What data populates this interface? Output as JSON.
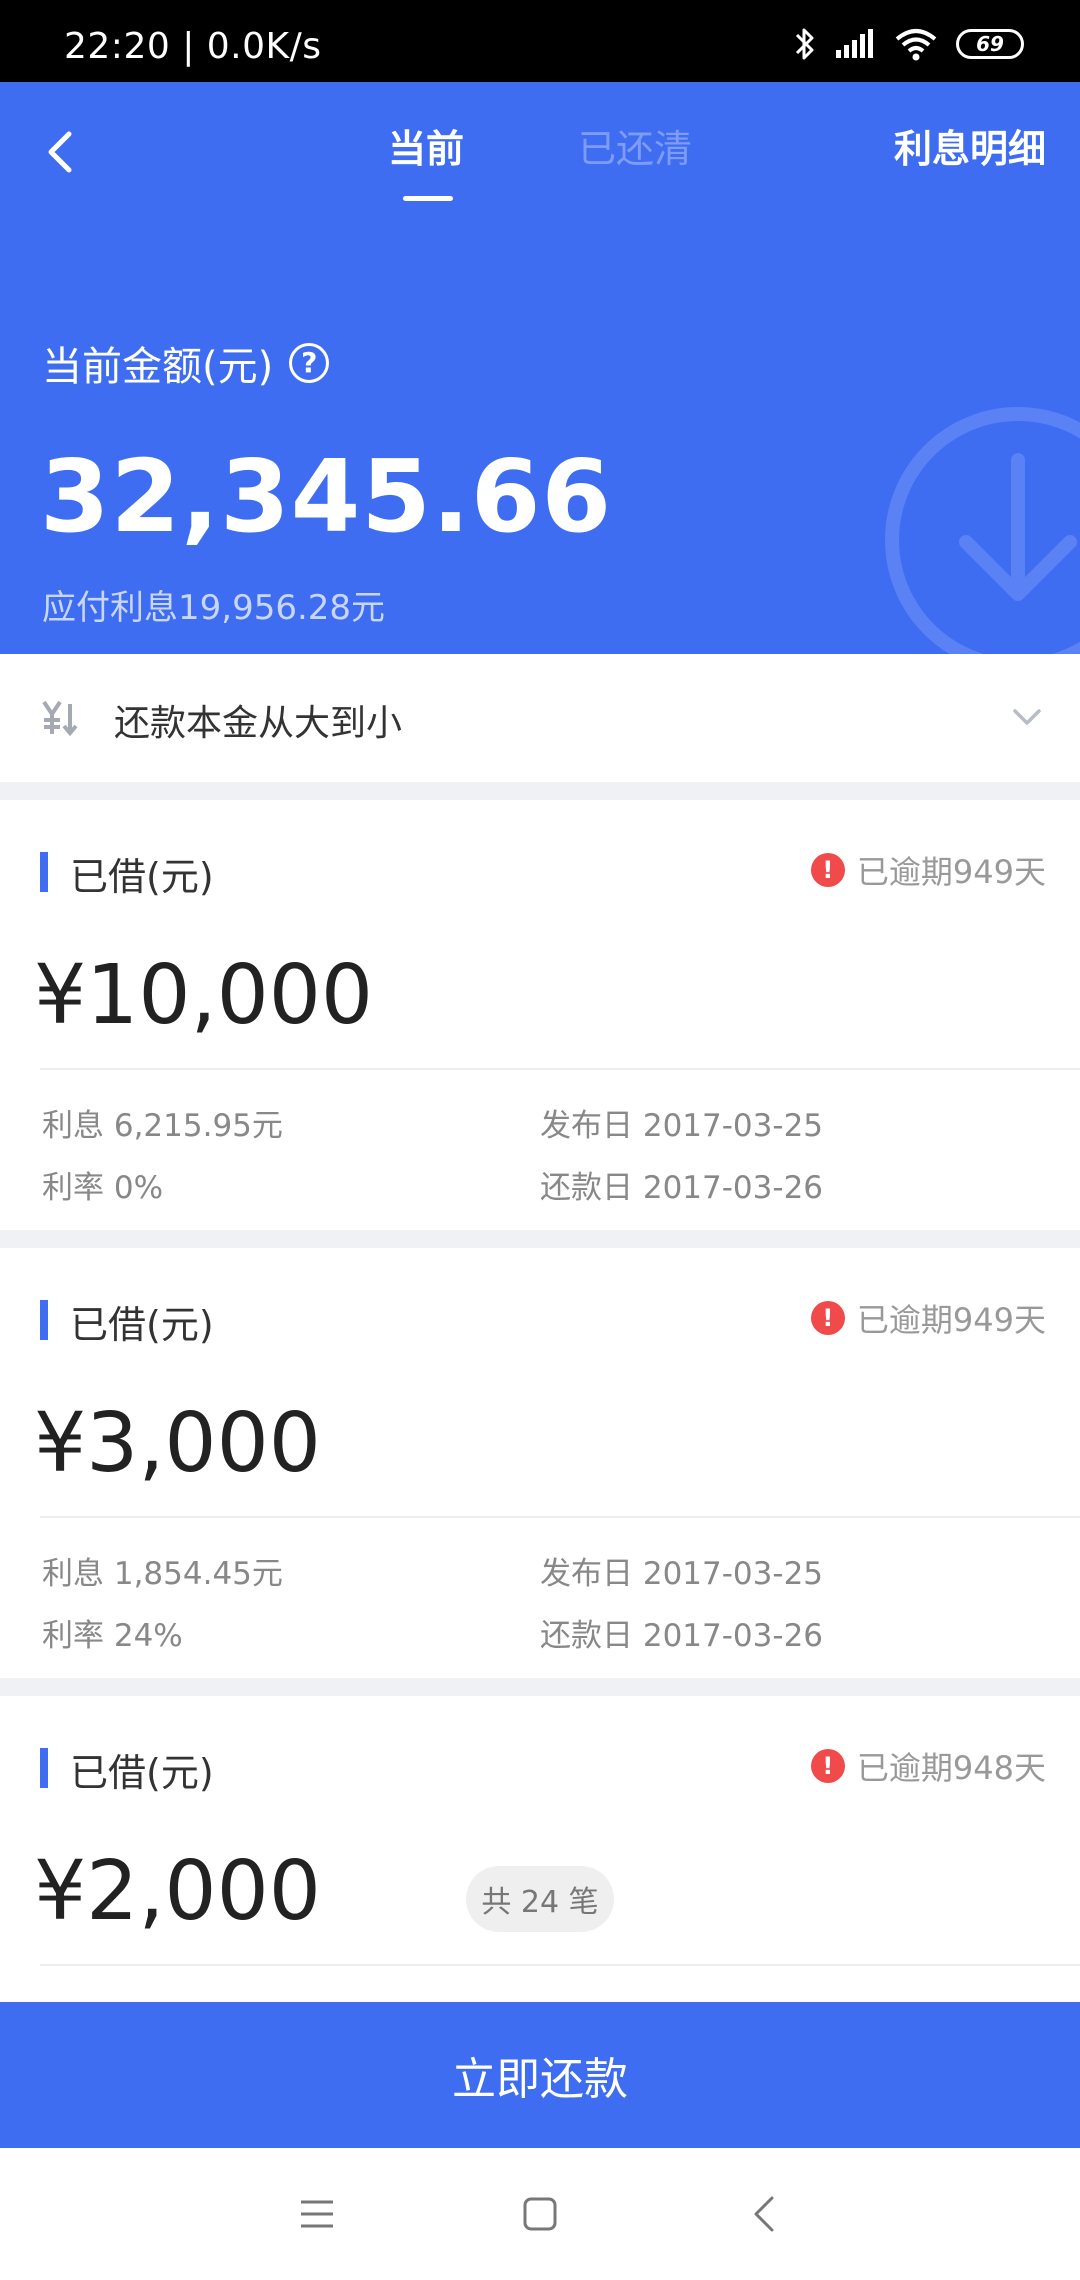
{
  "status_bar": {
    "time": "22:20",
    "network_speed": "0.0K/s",
    "battery": "69",
    "icons": [
      "bluetooth-icon",
      "signal-icon",
      "wifi-icon",
      "battery-icon"
    ]
  },
  "header": {
    "tabs": [
      {
        "label": "当前",
        "active": true
      },
      {
        "label": "已还清",
        "active": false
      }
    ],
    "interest_detail_label": "利息明细",
    "amount_label": "当前金额(元)",
    "amount_value": "32,345.66",
    "amount_sub": "应付利息19,956.28元"
  },
  "sort": {
    "label": "还款本金从大到小"
  },
  "loans": [
    {
      "title": "已借(元)",
      "overdue": "已逾期949天",
      "amount": "¥10,000",
      "interest": "利息 6,215.95元",
      "rate": "利率 0%",
      "publish_date": "发布日 2017-03-25",
      "repay_date": "还款日 2017-03-26"
    },
    {
      "title": "已借(元)",
      "overdue": "已逾期949天",
      "amount": "¥3,000",
      "interest": "利息 1,854.45元",
      "rate": "利率 24%",
      "publish_date": "发布日 2017-03-25",
      "repay_date": "还款日 2017-03-26"
    },
    {
      "title": "已借(元)",
      "overdue": "已逾期948天",
      "amount": "¥2,000",
      "count_badge": "共 24 笔"
    }
  ],
  "pay_button": "立即还款",
  "colors": {
    "primary": "#3f6df2",
    "alert": "#f14a4a"
  }
}
